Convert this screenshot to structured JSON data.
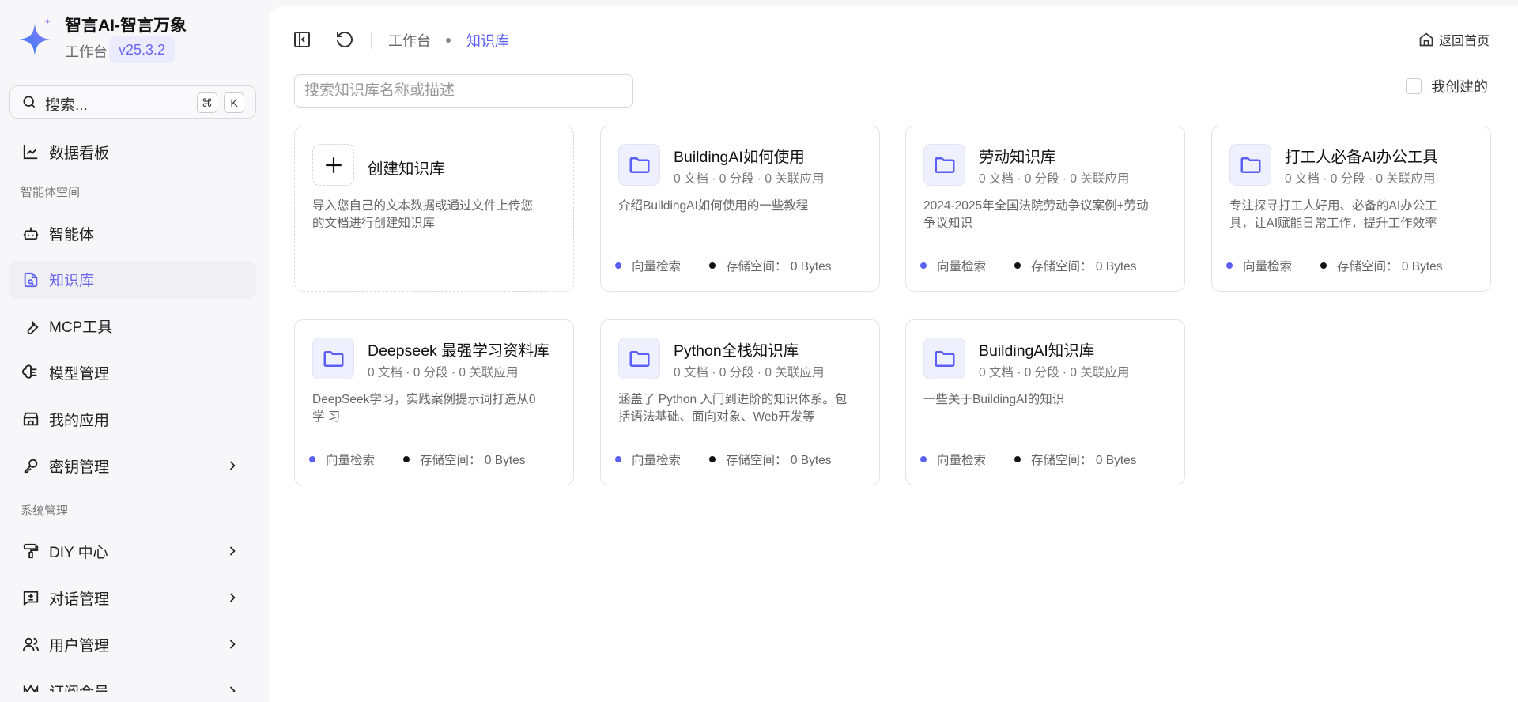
{
  "app": {
    "title": "智言AI-智言万象",
    "workspace": "工作台",
    "version": "v25.3.2"
  },
  "sidebar": {
    "search_placeholder": "搜索...",
    "shortcut_cmd": "⌘",
    "shortcut_key": "K",
    "dashboard": "数据看板",
    "section1": "智能体空间",
    "section2": "系统管理",
    "items": [
      {
        "label": "智能体",
        "icon": "bot-icon"
      },
      {
        "label": "知识库",
        "icon": "file-search-icon",
        "active": true
      },
      {
        "label": "MCP工具",
        "icon": "wrench-icon"
      },
      {
        "label": "模型管理",
        "icon": "brain-icon"
      },
      {
        "label": "我的应用",
        "icon": "store-icon"
      },
      {
        "label": "密钥管理",
        "icon": "key-icon",
        "chevron": true
      }
    ],
    "sys_items": [
      {
        "label": "DIY 中心",
        "icon": "paint-roller-icon",
        "chevron": true
      },
      {
        "label": "对话管理",
        "icon": "message-icon",
        "chevron": true
      },
      {
        "label": "用户管理",
        "icon": "users-icon",
        "chevron": true
      },
      {
        "label": "订阅会员",
        "icon": "crown-icon",
        "chevron": true
      }
    ]
  },
  "header": {
    "breadcrumb_root": "工作台",
    "breadcrumb_current": "知识库",
    "home_label": "返回首页"
  },
  "filters": {
    "search_placeholder": "搜索知识库名称或描述",
    "mine_label": "我创建的"
  },
  "create_card": {
    "title": "创建知识库",
    "description": "导入您自己的文本数据或通过文件上传您的文档进行创建知识库"
  },
  "cards": [
    {
      "title": "BuildingAI如何使用",
      "meta": "0 文档 · 0 分段 · 0 关联应用",
      "description": "介绍BuildingAI如何使用的一些教程",
      "retrieval": "向量检索",
      "storage": "存储空间： 0 Bytes"
    },
    {
      "title": "劳动知识库",
      "meta": "0 文档 · 0 分段 · 0 关联应用",
      "description": "2024-2025年全国法院劳动争议案例+劳动争议知识",
      "retrieval": "向量检索",
      "storage": "存储空间： 0 Bytes"
    },
    {
      "title": "打工人必备AI办公工具",
      "meta": "0 文档 · 0 分段 · 0 关联应用",
      "description": "专注探寻打工人好用、必备的AI办公工具，让AI赋能日常工作，提升工作效率",
      "retrieval": "向量检索",
      "storage": "存储空间： 0 Bytes"
    },
    {
      "title": "Deepseek 最强学习资料库",
      "meta": "0 文档 · 0 分段 · 0 关联应用",
      "description": "DeepSeek学习，实践案例提示词打造从0学 习",
      "retrieval": "向量检索",
      "storage": "存储空间： 0 Bytes"
    },
    {
      "title": "Python全栈知识库",
      "meta": "0 文档 · 0 分段 · 0 关联应用",
      "description": "涵盖了 Python 入门到进阶的知识体系。包括语法基础、面向对象、Web开发等",
      "retrieval": "向量检索",
      "storage": "存储空间： 0 Bytes"
    },
    {
      "title": "BuildingAI知识库",
      "meta": "0 文档 · 0 分段 · 0 关联应用",
      "description": "一些关于BuildingAI的知识",
      "retrieval": "向量检索",
      "storage": "存储空间： 0 Bytes"
    }
  ],
  "colors": {
    "accent": "#5b5ff5",
    "badge_bg": "#ecebfd"
  }
}
